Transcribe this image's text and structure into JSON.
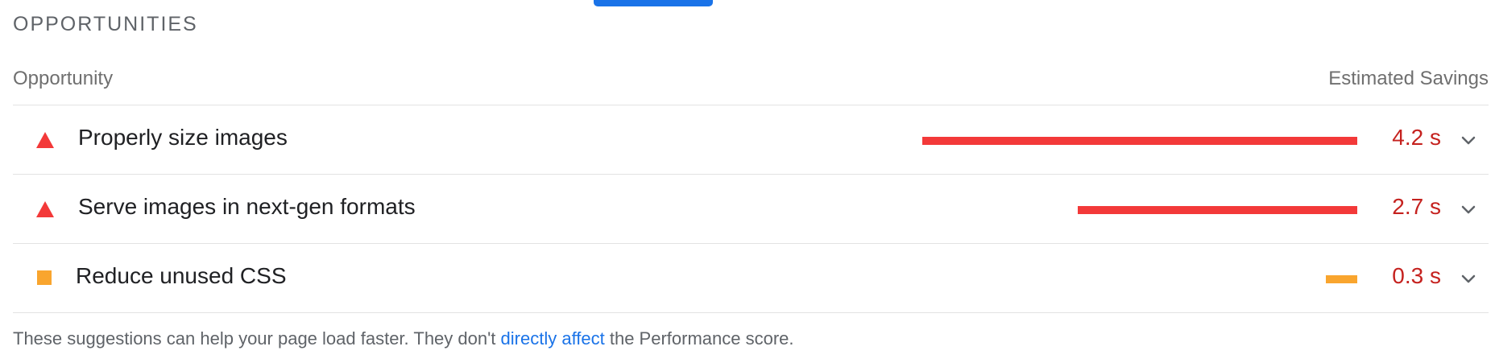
{
  "section": {
    "title": "OPPORTUNITIES"
  },
  "table": {
    "col_opportunity": "Opportunity",
    "col_savings": "Estimated Savings"
  },
  "opportunities": [
    {
      "title": "Properly size images",
      "savings_label": "4.2 s",
      "savings_seconds": 4.2,
      "severity": "fail",
      "icon": "red-triangle-icon",
      "bar_color": "#f33939",
      "text_color": "#c5221f"
    },
    {
      "title": "Serve images in next-gen formats",
      "savings_label": "2.7 s",
      "savings_seconds": 2.7,
      "severity": "fail",
      "icon": "red-triangle-icon",
      "bar_color": "#f33939",
      "text_color": "#c5221f"
    },
    {
      "title": "Reduce unused CSS",
      "savings_label": "0.3 s",
      "savings_seconds": 0.3,
      "severity": "average",
      "icon": "orange-square-icon",
      "bar_color": "#f9a52e",
      "text_color": "#c5221f"
    }
  ],
  "footer": {
    "text_before": "These suggestions can help your page load faster. They don't ",
    "link_text": "directly affect",
    "text_after": " the Performance score."
  },
  "colors": {
    "accent_blue": "#1a73e8",
    "fail_red": "#f33939",
    "average_orange": "#f9a52e"
  }
}
